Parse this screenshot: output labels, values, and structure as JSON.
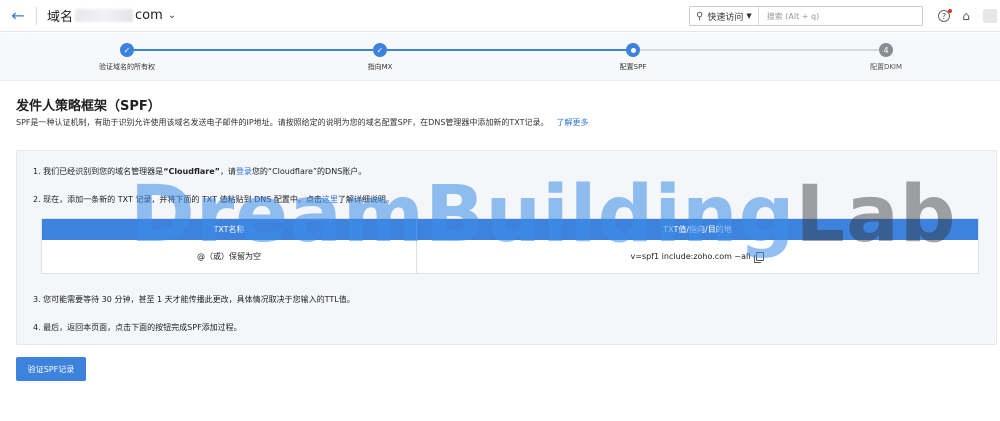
{
  "header": {
    "domain_label": "域名",
    "domain_suffix": "com",
    "search_scope": "快速访问",
    "search_placeholder": "搜索 (Alt + q)"
  },
  "stepper": {
    "steps": [
      {
        "label": "验证域名的所有权",
        "status": "done"
      },
      {
        "label": "指向MX",
        "status": "done"
      },
      {
        "label": "配置SPF",
        "status": "current"
      },
      {
        "label": "配置DKIM",
        "status": "pending",
        "number": "4"
      }
    ],
    "colors": {
      "active": "#3d83dd",
      "pending": "#8a8d93"
    }
  },
  "page": {
    "title": "发件人策略框架（SPF）",
    "description": "SPF是一种认证机制，有助于识别允许使用该域名发送电子邮件的IP地址。请按照给定的说明为您的域名配置SPF，在DNS管理器中添加新的TXT记录。",
    "learn_more": "了解更多"
  },
  "instructions": {
    "step1_pre": "1. 我们已经识别到您的域名管理器是",
    "step1_provider": "“Cloudflare”",
    "step1_mid": "，请",
    "step1_link": "登录",
    "step1_post": "您的“Cloudflare”的DNS账户。",
    "step2_pre": "2. 现在，添加一条新的 TXT 记录，并将下面的 TXT 值粘贴到 DNS 配置中。点击",
    "step2_link": "这里",
    "step2_post": "了解详细说明。",
    "step3": "3. 您可能需要等待 30 分钟，甚至 1 天才能传播此更改，具体情况取决于您输入的TTL值。",
    "step4": "4. 最后，返回本页面，点击下面的按钮完成SPF添加过程。"
  },
  "dns_table": {
    "headers": [
      "TXT名称",
      "TXT值/指向/目的地"
    ],
    "row": {
      "name": "@（或）保留为空",
      "value": "v=spf1 include:zoho.com ~all"
    }
  },
  "verify_button": "验证SPF记录",
  "watermark": {
    "part1": "Dream",
    "part2": "Building",
    "part3": "Lab"
  }
}
